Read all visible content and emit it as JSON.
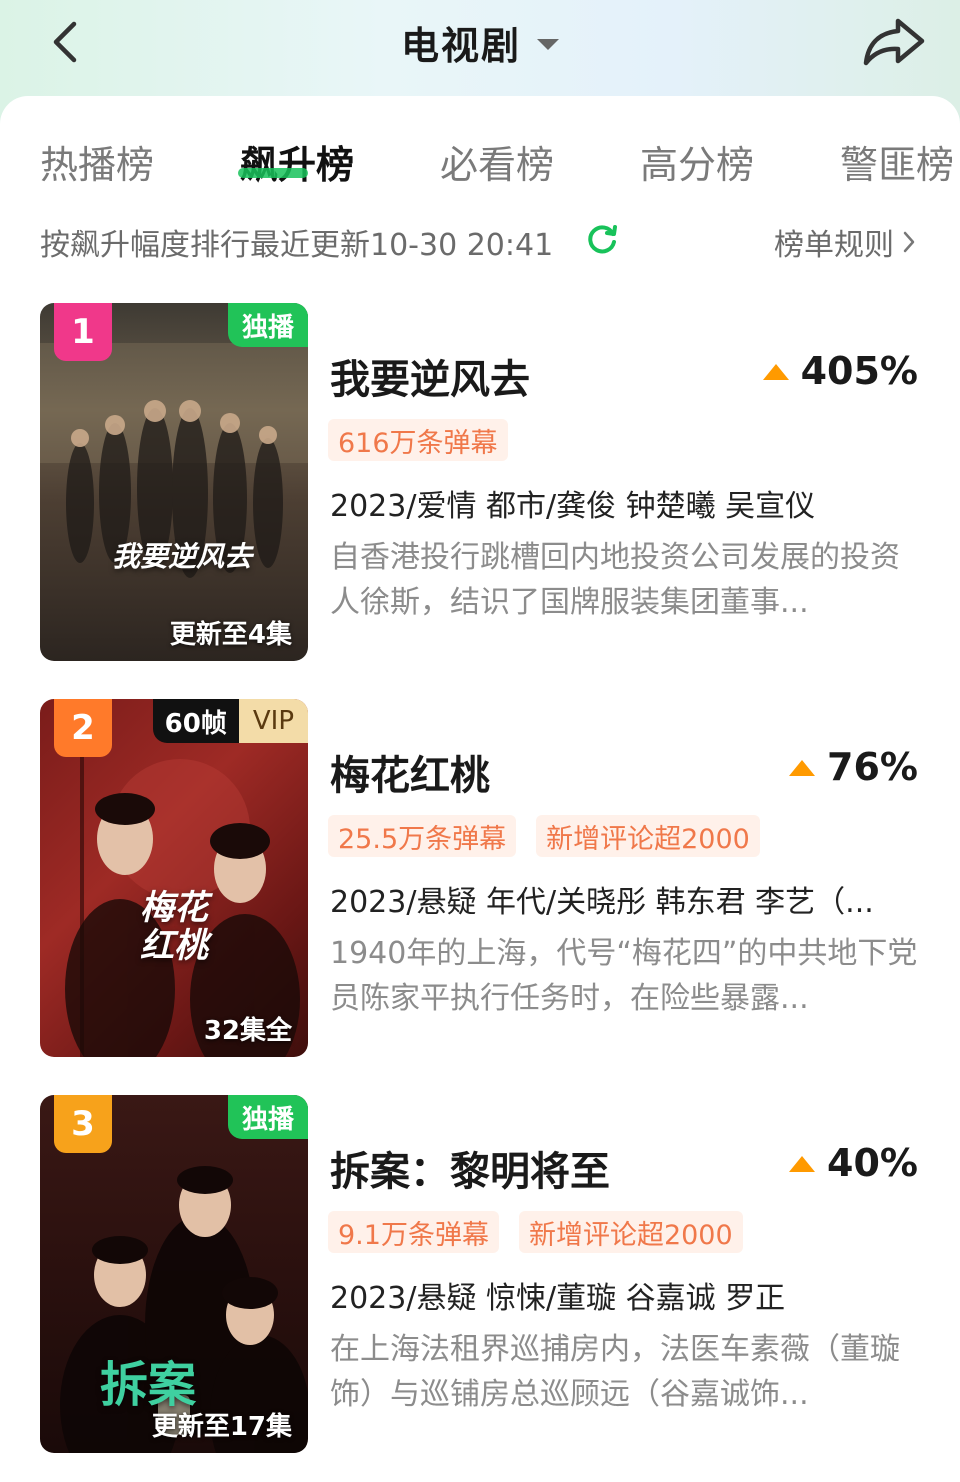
{
  "header": {
    "title": "电视剧",
    "back_icon": "chevron-left-icon",
    "share_icon": "share-icon"
  },
  "tabs": [
    {
      "label": "热播榜",
      "active": false
    },
    {
      "label": "飙升榜",
      "active": true
    },
    {
      "label": "必看榜",
      "active": false
    },
    {
      "label": "高分榜",
      "active": false
    },
    {
      "label": "警匪榜",
      "active": false
    }
  ],
  "subbar": {
    "sort_text": "按飙升幅度排行最近更新10-30 20:41",
    "rules_label": "榜单规则"
  },
  "colors": {
    "accent_green": "#18c25a",
    "rank1": "#f0388a",
    "rank2": "#ff7a2a",
    "rank3": "#f7a21b",
    "tag_text": "#f0784a",
    "rise_arrow": "#ff9a00"
  },
  "items": [
    {
      "rank": "1",
      "badge": "独播",
      "poster_title": "我要逆风去",
      "episode_status": "更新至4集",
      "title": "我要逆风去",
      "rise": "405%",
      "tags": [
        "616万条弹幕"
      ],
      "meta": "2023/爱情 都市/龚俊 钟楚曦 吴宣仪",
      "desc": "自香港投行跳槽回内地投资公司发展的投资人徐斯，结识了国牌服装集团董事..."
    },
    {
      "rank": "2",
      "badge_fps": "60帧",
      "badge_vip": "VIP",
      "poster_title": "梅花红桃",
      "episode_status": "32集全",
      "title": "梅花红桃",
      "rise": "76%",
      "tags": [
        "25.5万条弹幕",
        "新增评论超2000"
      ],
      "meta": "2023/悬疑 年代/关晓彤 韩东君 李艺（...",
      "desc": "1940年的上海，代号“梅花四”的中共地下党员陈家平执行任务时，在险些暴露..."
    },
    {
      "rank": "3",
      "badge": "独播",
      "poster_title": "拆案",
      "episode_status": "更新至17集",
      "title": "拆案：黎明将至",
      "rise": "40%",
      "tags": [
        "9.1万条弹幕",
        "新增评论超2000"
      ],
      "meta": "2023/悬疑 惊悚/董璇 谷嘉诚 罗正",
      "desc": "在上海法租界巡捕房内，法医车素薇（董璇饰）与巡铺房总巡顾远（谷嘉诚饰..."
    }
  ]
}
